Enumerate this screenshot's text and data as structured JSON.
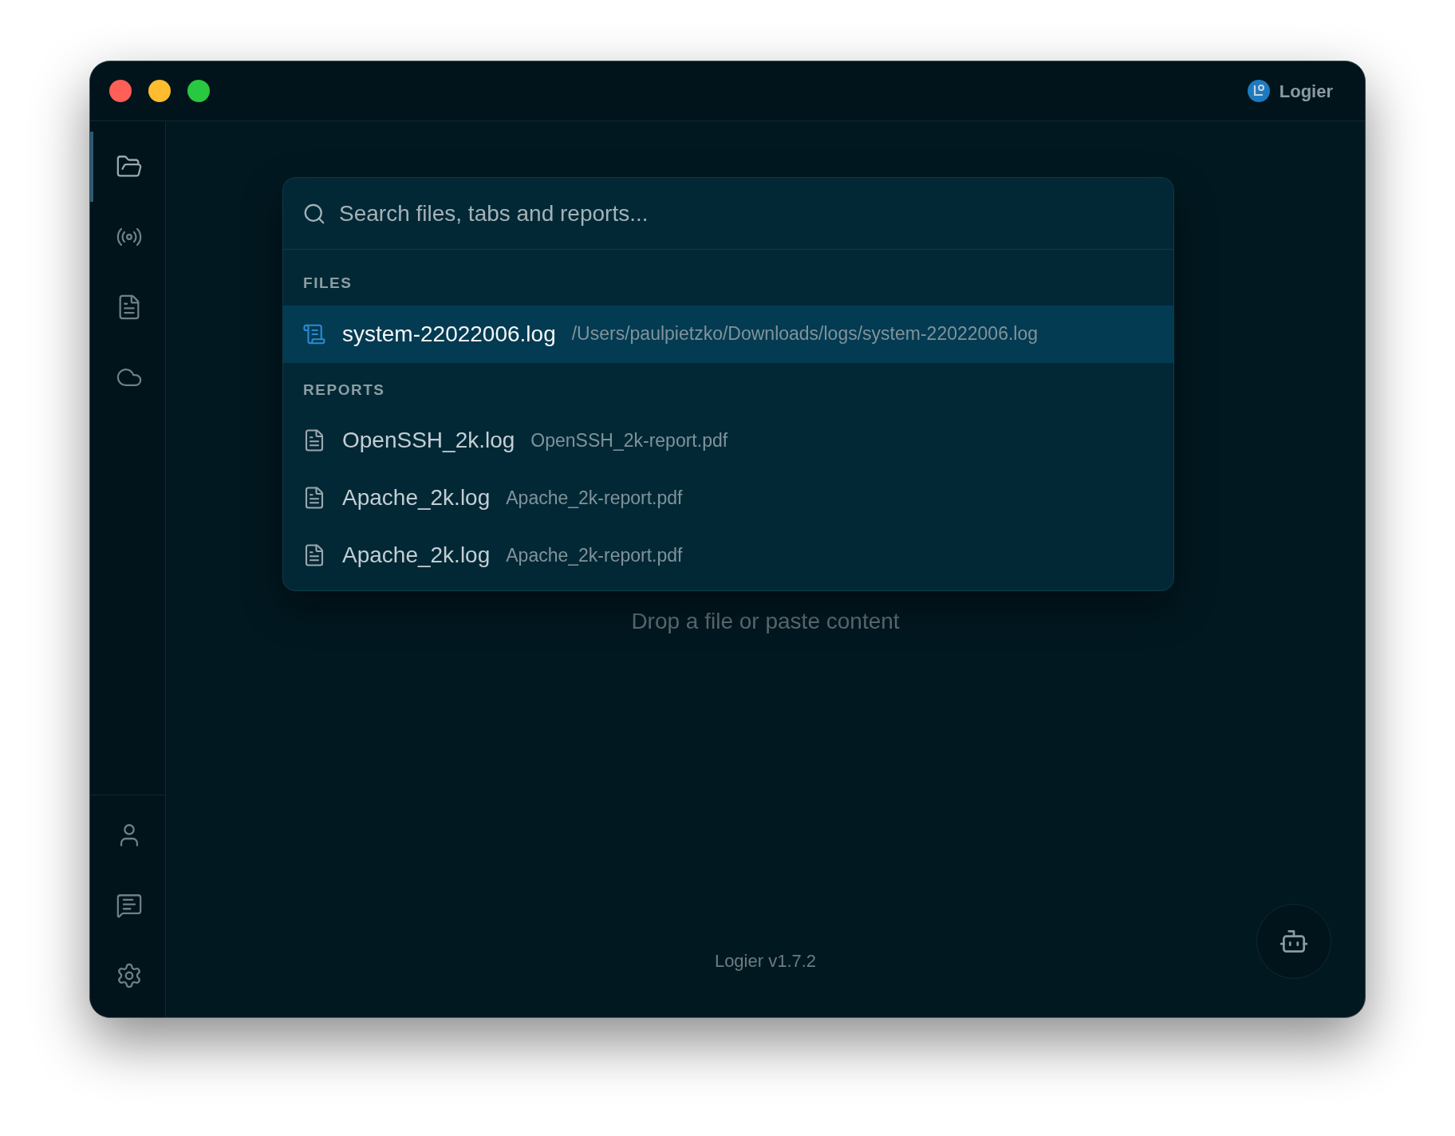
{
  "window": {
    "title": "Logier"
  },
  "sidebar": {
    "items": [
      {
        "selected": true
      },
      {
        "selected": false
      },
      {
        "selected": false
      },
      {
        "selected": false
      }
    ]
  },
  "command_palette": {
    "search": {
      "placeholder": "Search files, tabs and reports..."
    },
    "sections": [
      {
        "title": "FILES",
        "items": [
          {
            "kind": "file",
            "name": "system-22022006.log",
            "detail": "/Users/paulpietzko/Downloads/logs/system-22022006.log",
            "selected": true
          }
        ]
      },
      {
        "title": "REPORTS",
        "items": [
          {
            "kind": "report",
            "name": "OpenSSH_2k.log",
            "detail": "OpenSSH_2k-report.pdf",
            "selected": false
          },
          {
            "kind": "report",
            "name": "Apache_2k.log",
            "detail": "Apache_2k-report.pdf",
            "selected": false
          },
          {
            "kind": "report",
            "name": "Apache_2k.log",
            "detail": "Apache_2k-report.pdf",
            "selected": false
          }
        ]
      }
    ]
  },
  "empty_state": {
    "subtitle": "Drop a file or paste content"
  },
  "footer": {
    "version": "Logier v1.7.2"
  }
}
